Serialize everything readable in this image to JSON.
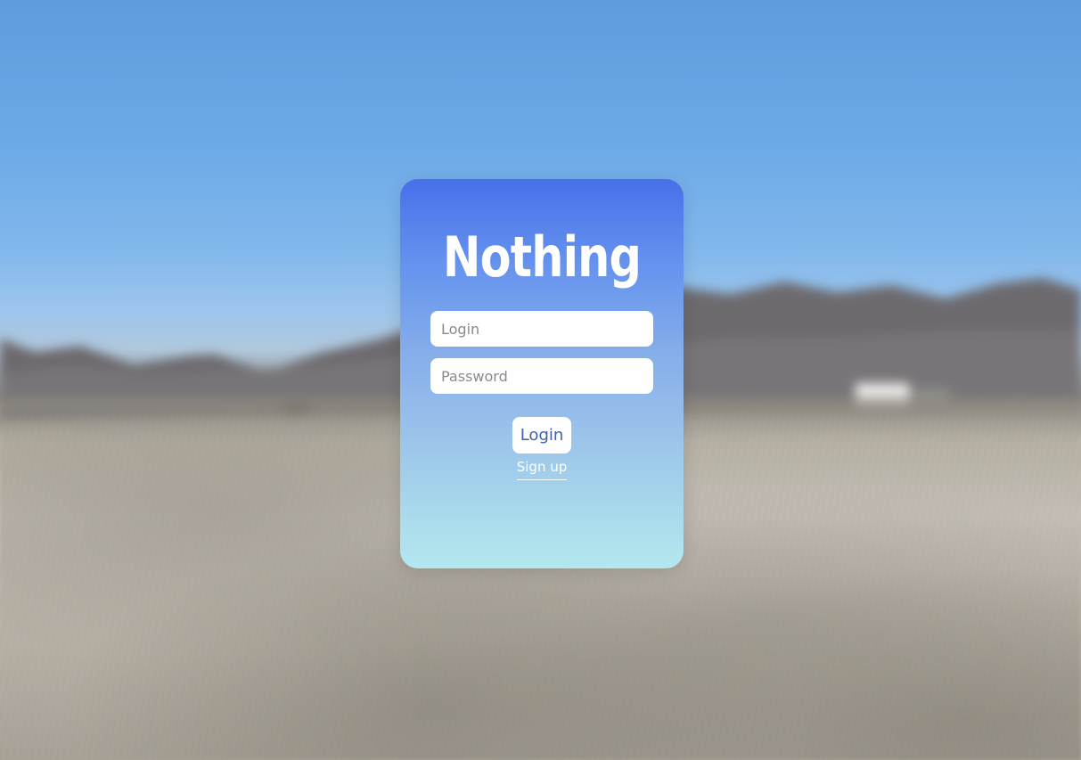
{
  "app": {
    "brand": "Nothing"
  },
  "form": {
    "login_placeholder": "Login",
    "login_value": "",
    "password_placeholder": "Password",
    "password_value": "",
    "submit_label": "Login",
    "signup_label": "Sign up"
  },
  "colors": {
    "card_top": "#4770ea",
    "card_bottom": "#b4e8f0",
    "button_text": "#3f5fb5"
  }
}
